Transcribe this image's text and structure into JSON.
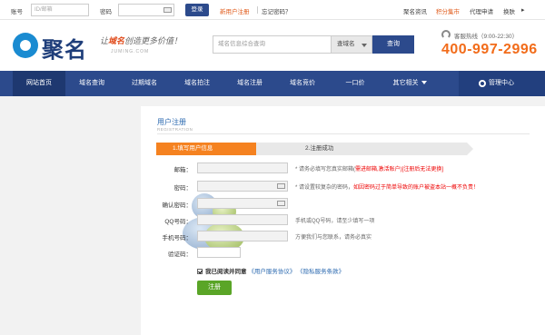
{
  "topbar": {
    "account_label": "账号",
    "account_placeholder": "ID/邮箱",
    "password_label": "密码",
    "login_label": "登录",
    "register_link": "新用户注册",
    "forgot_link": "忘记密码？",
    "links": [
      "聚名资讯",
      "积分集市",
      "代理申请",
      "换肤"
    ]
  },
  "header": {
    "logo_text": "聚名",
    "slogan_pre": "让",
    "slogan_hl": "域名",
    "slogan_post": "创造更多价值！",
    "domain_sub": "JUMING.COM",
    "search_placeholder": "域名信息综合查询",
    "search_select": "查域名",
    "search_button": "查询",
    "hotline": "客服热线（9:00-22:30）",
    "phone": "400-997-2996"
  },
  "nav": {
    "items": [
      "网站首页",
      "域名查询",
      "过期域名",
      "域名拍注",
      "域名注册",
      "域名竞价",
      "一口价",
      "其它相关"
    ],
    "management": "管理中心"
  },
  "registration": {
    "title": "用户注册",
    "subtitle": "REGISTRATION",
    "step1": "1.填写用户信息",
    "step2": "2.注册成功",
    "fields": {
      "email_label": "邮箱：",
      "password_label": "密码：",
      "confirm_label": "确认密码：",
      "qq_label": "QQ号码：",
      "mobile_label": "手机号码：",
      "captcha_label": "验证码："
    },
    "hints": {
      "email_pre": "* 请务必填写您真实邮箱(",
      "email_red": "需进邮箱,激活账户)[注册后无法更换]",
      "email_post": "",
      "password_pre": "* 请设置较复杂的密码，",
      "password_red": "如因密码过于简单导致的账户被盗本站一概不负责！",
      "qq": "手机或QQ号码，请至少填写一项",
      "mobile": "方便我们与您联系，请务必真实"
    },
    "agree_text": "我已阅读并同意",
    "agree_link1": "《用户服务协议》",
    "agree_link2": "《隐私服务条款》",
    "register_button": "注册"
  }
}
